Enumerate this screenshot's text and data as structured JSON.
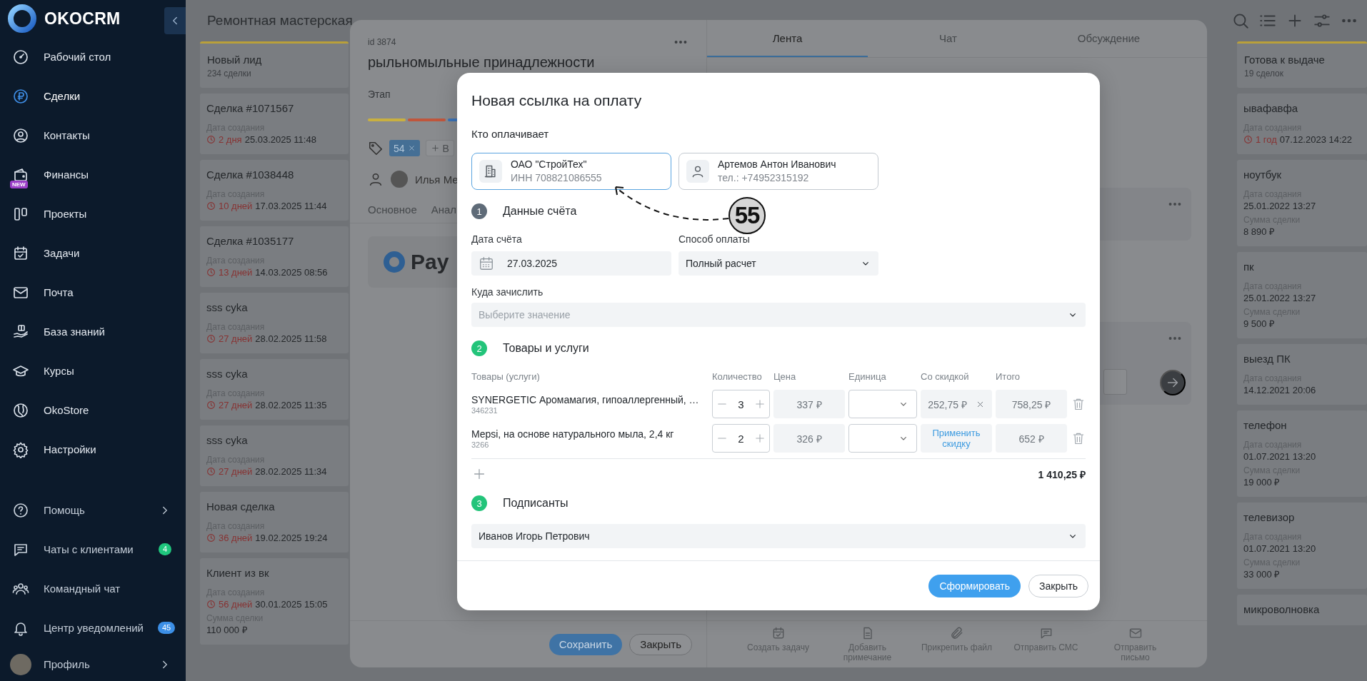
{
  "sidebar": {
    "logo": "OKOCRM",
    "items": [
      {
        "label": "Рабочий стол",
        "selected": false
      },
      {
        "label": "Сделки",
        "selected": true
      },
      {
        "label": "Контакты",
        "selected": false
      },
      {
        "label": "Финансы",
        "selected": false,
        "badge": {
          "text": "NEW",
          "color": "#9b3fc8"
        }
      },
      {
        "label": "Проекты",
        "selected": false
      },
      {
        "label": "Задачи",
        "selected": false
      },
      {
        "label": "Почта",
        "selected": false
      },
      {
        "label": "База знаний",
        "selected": false
      },
      {
        "label": "Курсы",
        "selected": false
      },
      {
        "label": "OkoStore",
        "selected": false
      },
      {
        "label": "Настройки",
        "selected": false
      }
    ],
    "bottom_items": [
      {
        "label": "Помощь",
        "has_submenu": true
      },
      {
        "label": "Чаты с клиентами",
        "badge": {
          "text": "4",
          "color": "#1fc77e"
        }
      },
      {
        "label": "Командный чат"
      },
      {
        "label": "Центр уведомлений",
        "badge": {
          "text": "45",
          "color": "#3c8fe6"
        }
      }
    ],
    "profile": {
      "label": "Профиль",
      "has_submenu": true
    }
  },
  "board": {
    "title": "Ремонтная мастерская",
    "columns": [
      {
        "name": "Новый лид",
        "count": "234 сделки",
        "color": "#b9a03a",
        "cards": [
          {
            "title": "Сделка #1071567",
            "date_label": "Дата создания",
            "age": "2 дня",
            "date": "25.03.2025 11:48"
          },
          {
            "title": "Сделка #1038448",
            "date_label": "Дата создания",
            "age": "10 дней",
            "date": "17.03.2025 11:44"
          },
          {
            "title": "Сделка #1035177",
            "date_label": "Дата создания",
            "age": "13 дней",
            "date": "14.03.2025 08:56"
          },
          {
            "title": "sss cyka",
            "date_label": "Дата создания",
            "age": "27 дней",
            "date": "28.02.2025 11:58"
          },
          {
            "title": "sss cyka",
            "date_label": "Дата создания",
            "age": "27 дней",
            "date": "28.02.2025 11:35"
          },
          {
            "title": "sss cyka",
            "date_label": "Дата создания",
            "age": "27 дней",
            "date": "28.02.2025 11:34"
          },
          {
            "title": "Новая сделка",
            "date_label": "Дата создания",
            "age": "36 дней",
            "date": "19.02.2025 19:24"
          },
          {
            "title": "Клиент из вк",
            "date_label": "Дата создания",
            "age": "56 дней",
            "date": "30.01.2025 15:05",
            "sum_label": "Сумма сделки",
            "sum": "110 000 ₽"
          }
        ]
      },
      {
        "name": "Готова к выдаче",
        "count": "19 сделок",
        "color": "#b9a03a",
        "cards": [
          {
            "title": "ывафавфа",
            "date_label": "Дата создания",
            "age": "1 год",
            "date": "07.12.2023 14:22"
          },
          {
            "title": "ноутбук",
            "date_label": "Дата создания",
            "date": "25.01.2022 13:27",
            "sum_label": "Сумма сделки",
            "sum": "8 890 ₽"
          },
          {
            "title": "пк",
            "date_label": "Дата создания",
            "date": "25.01.2022 13:27",
            "sum_label": "Сумма сделки",
            "sum": "9 500 ₽"
          },
          {
            "title": "выезд ПК",
            "date_label": "Дата создания",
            "date": "14.12.2021 20:06"
          },
          {
            "title": "телефон",
            "date_label": "Дата создания",
            "date": "01.07.2021 13:20",
            "sum_label": "Сумма сделки",
            "sum": "19 000 ₽"
          },
          {
            "title": "телевизор",
            "date_label": "Дата создания",
            "date": "01.07.2021 13:20",
            "sum_label": "Сумма сделки",
            "sum": "33 000 ₽"
          },
          {
            "title": "микроволновка"
          }
        ]
      }
    ]
  },
  "deal": {
    "id": "id 3874",
    "title": "рыльномыльные принадлежности",
    "stage_label": "Этап",
    "stages": [
      {
        "color": "#c9b040"
      },
      {
        "color": "#c0563c"
      },
      {
        "color": "#3b73b8"
      }
    ],
    "tags": [
      {
        "label": "54"
      }
    ],
    "add_tag": "В",
    "responsible": "Илья Ме",
    "tabs": [
      {
        "label": "Основное"
      },
      {
        "label": "Анал"
      }
    ],
    "payment_logo": "Pay",
    "save_button": "Сохранить",
    "close_button": "Закрыть"
  },
  "feed": {
    "tabs": [
      {
        "label": "Лента",
        "selected": true
      },
      {
        "label": "Чат",
        "selected": false
      },
      {
        "label": "Обсуждение",
        "selected": false
      }
    ],
    "actions": [
      {
        "label": "Создать задачу"
      },
      {
        "label": "Добавить примечание"
      },
      {
        "label": "Прикрепить файл"
      },
      {
        "label": "Отправить СМС"
      },
      {
        "label": "Отправить письмо"
      }
    ]
  },
  "payment_modal": {
    "title": "Новая ссылка на оплату",
    "payer_label": "Кто оплачивает",
    "payers": [
      {
        "kind": "company",
        "name": "ОАО \"СтройТех\"",
        "detail": "ИНН 708821086555",
        "selected": true
      },
      {
        "kind": "person",
        "name": "Артемов Антон Иванович",
        "detail": "тел.: +74952315192",
        "selected": false
      }
    ],
    "sections": [
      {
        "number": "1",
        "title": "Данные счёта",
        "done": false
      },
      {
        "number": "2",
        "title": "Товары и услуги",
        "done": true
      },
      {
        "number": "3",
        "title": "Подписанты",
        "done": true
      }
    ],
    "invoice_date": {
      "label": "Дата счёта",
      "value": "27.03.2025"
    },
    "payment_method": {
      "label": "Способ оплаты",
      "value": "Полный расчет"
    },
    "destination": {
      "label": "Куда зачислить",
      "placeholder": "Выберите значение"
    },
    "columns": [
      "Товары (услуги)",
      "Количество",
      "Цена",
      "Единица",
      "Со скидкой",
      "Итого"
    ],
    "rows": [
      {
        "name": "SYNERGETIC Аромамагия, гипоаллергенный, …",
        "sku": "346231",
        "quantity": "3",
        "price": "337 ₽",
        "discount": {
          "kind": "value",
          "text": "252,75 ₽"
        },
        "total": "758,25 ₽"
      },
      {
        "name": "Mepsi, на основе натурального мыла, 2,4 кг",
        "sku": "3266",
        "quantity": "2",
        "price": "326 ₽",
        "discount": {
          "kind": "link",
          "text": "Применить скидку"
        },
        "total": "652 ₽"
      }
    ],
    "grand_total": "1 410,25 ₽",
    "signer": {
      "value": "Иванов Игорь Петрович"
    },
    "submit_button": "Сформировать",
    "close_button": "Закрыть",
    "annotation": {
      "label": "55"
    }
  }
}
